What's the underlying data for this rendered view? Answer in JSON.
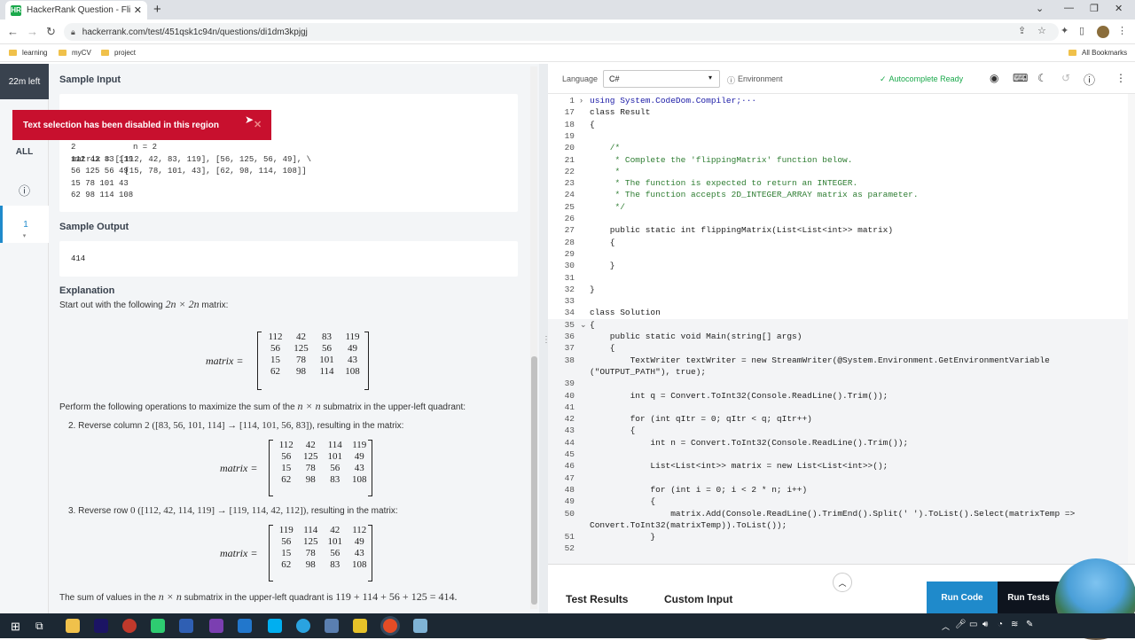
{
  "browser": {
    "tab_title": "HackerRank Question - Flipping",
    "tab_favicon": "HR",
    "url": "hackerrank.com/test/451qsk1c94n/questions/di1dm3kpjgj",
    "bookmarks": [
      "learning",
      "myCV",
      "project"
    ],
    "all_bookmarks": "All Bookmarks"
  },
  "rail": {
    "timer": "22m left",
    "all": "ALL",
    "info_icon": "info-icon",
    "question_number": "1"
  },
  "toast": "Text selection has been disabled in this region",
  "problem": {
    "sample_input_title": "Sample Input",
    "sample_input_left": [
      "2",
      "112 42 83 119",
      "56 125 56 49",
      "15 78 101 43",
      "62 98 114 108"
    ],
    "sample_input_right": [
      "n = 2",
      "matrix = [[112, 42, 83, 119], [56, 125, 56, 49], \\",
      "           [15, 78, 101, 43], [62, 98, 114, 108]]"
    ],
    "sample_output_title": "Sample Output",
    "sample_output": "414",
    "explanation_title": "Explanation",
    "start_text": "Start out with the following",
    "start_math": "2n × 2n",
    "start_suffix": "matrix:",
    "matrix_label": "matrix =",
    "matrix1": [
      "112",
      "42",
      "83",
      "119",
      "56",
      "125",
      "56",
      "49",
      "15",
      "78",
      "101",
      "43",
      "62",
      "98",
      "114",
      "108"
    ],
    "perform_text": "Perform the following operations to maximize the sum of the",
    "perform_math": "n × n",
    "perform_suffix": "submatrix in the upper-left quadrant:",
    "step2_prefix": "2. Reverse column",
    "step2_math": "2 ([83, 56, 101, 114] → [114, 101, 56, 83])",
    "step2_suffix": ", resulting in the matrix:",
    "matrix2": [
      "112",
      "42",
      "114",
      "119",
      "56",
      "125",
      "101",
      "49",
      "15",
      "78",
      "56",
      "43",
      "62",
      "98",
      "83",
      "108"
    ],
    "step3_prefix": "3. Reverse row",
    "step3_math": "0 ([112, 42, 114, 119] → [119, 114, 42, 112])",
    "step3_suffix": ", resulting in the matrix:",
    "matrix3": [
      "119",
      "114",
      "42",
      "112",
      "56",
      "125",
      "101",
      "49",
      "15",
      "78",
      "56",
      "43",
      "62",
      "98",
      "83",
      "108"
    ],
    "sum_prefix": "The sum of values in the",
    "sum_math1": "n × n",
    "sum_mid": "submatrix in the upper-left quadrant is",
    "sum_math2": "119 + 114 + 56 + 125 = 414."
  },
  "editor": {
    "language_label": "Language",
    "language": "C#",
    "environment": "Environment",
    "autocomplete": "Autocomplete Ready",
    "lines": [
      {
        "n": "1",
        "t": "using System.CodeDom.Compiler;···",
        "c": "kw"
      },
      {
        "n": "17",
        "t": "class Result",
        "c": ""
      },
      {
        "n": "18",
        "t": "{",
        "c": ""
      },
      {
        "n": "19",
        "t": "",
        "c": ""
      },
      {
        "n": "20",
        "t": "    /*",
        "c": "cm"
      },
      {
        "n": "21",
        "t": "     * Complete the 'flippingMatrix' function below.",
        "c": "cm"
      },
      {
        "n": "22",
        "t": "     *",
        "c": "cm"
      },
      {
        "n": "23",
        "t": "     * The function is expected to return an INTEGER.",
        "c": "cm"
      },
      {
        "n": "24",
        "t": "     * The function accepts 2D_INTEGER_ARRAY matrix as parameter.",
        "c": "cm"
      },
      {
        "n": "25",
        "t": "     */",
        "c": "cm"
      },
      {
        "n": "26",
        "t": "",
        "c": ""
      },
      {
        "n": "27",
        "t": "    public static int flippingMatrix(List<List<int>> matrix)",
        "c": ""
      },
      {
        "n": "28",
        "t": "    {",
        "c": ""
      },
      {
        "n": "29",
        "t": "",
        "c": ""
      },
      {
        "n": "30",
        "t": "    }",
        "c": ""
      },
      {
        "n": "31",
        "t": "",
        "c": ""
      },
      {
        "n": "32",
        "t": "}",
        "c": ""
      },
      {
        "n": "33",
        "t": "",
        "c": ""
      },
      {
        "n": "34",
        "t": "class Solution",
        "c": ""
      },
      {
        "n": "35",
        "t": "{",
        "c": ""
      },
      {
        "n": "36",
        "t": "    public static void Main(string[] args)",
        "c": ""
      },
      {
        "n": "37",
        "t": "    {",
        "c": ""
      },
      {
        "n": "38",
        "t": "        TextWriter textWriter = new StreamWriter(@System.Environment.GetEnvironmentVariable",
        "c": ""
      },
      {
        "n": "",
        "t": "(\"OUTPUT_PATH\"), true);",
        "c": ""
      },
      {
        "n": "39",
        "t": "",
        "c": ""
      },
      {
        "n": "40",
        "t": "        int q = Convert.ToInt32(Console.ReadLine().Trim());",
        "c": ""
      },
      {
        "n": "41",
        "t": "",
        "c": ""
      },
      {
        "n": "42",
        "t": "        for (int qItr = 0; qItr < q; qItr++)",
        "c": ""
      },
      {
        "n": "43",
        "t": "        {",
        "c": ""
      },
      {
        "n": "44",
        "t": "            int n = Convert.ToInt32(Console.ReadLine().Trim());",
        "c": ""
      },
      {
        "n": "45",
        "t": "",
        "c": ""
      },
      {
        "n": "46",
        "t": "            List<List<int>> matrix = new List<List<int>>();",
        "c": ""
      },
      {
        "n": "47",
        "t": "",
        "c": ""
      },
      {
        "n": "48",
        "t": "            for (int i = 0; i < 2 * n; i++)",
        "c": ""
      },
      {
        "n": "49",
        "t": "            {",
        "c": ""
      },
      {
        "n": "50",
        "t": "                matrix.Add(Console.ReadLine().TrimEnd().Split(' ').ToList().Select(matrixTemp =>",
        "c": ""
      },
      {
        "n": "",
        "t": "Convert.ToInt32(matrixTemp)).ToList());",
        "c": ""
      },
      {
        "n": "51",
        "t": "            }",
        "c": ""
      },
      {
        "n": "52",
        "t": "",
        "c": ""
      }
    ]
  },
  "bottom": {
    "test_results": "Test Results",
    "custom_input": "Custom Input",
    "run_code": "Run Code",
    "run_tests": "Run Tests"
  },
  "colors": {
    "accent": "#1f8acb",
    "toast": "#c8102e",
    "green": "#1ba94c",
    "dark": "#0e141e"
  }
}
